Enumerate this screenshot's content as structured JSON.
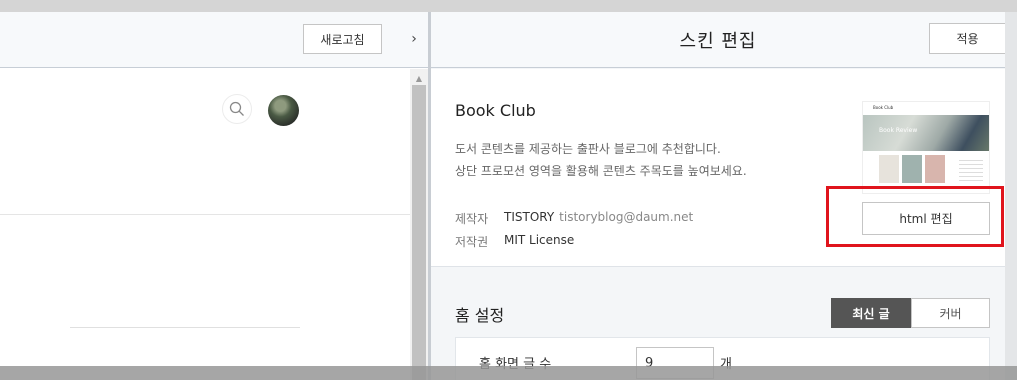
{
  "left_pane": {
    "refresh_label": "새로고침",
    "collapse_glyph": "›"
  },
  "editor": {
    "title": "스킨 편집",
    "apply_label": "적용"
  },
  "skin": {
    "name": "Book Club",
    "description_line1": "도서 콘텐츠를 제공하는 출판사 블로그에 추천합니다.",
    "description_line2": "상단 프로모션 영역을 활용해 콘텐츠 주목도를 높여보세요.",
    "maker_label": "제작자",
    "maker_name": "TISTORY",
    "maker_email": "tistoryblog@daum.net",
    "license_label": "저작권",
    "license_value": "MIT License",
    "thumbnail": {
      "blog_name": "Book Club",
      "hero_text": "Book Review"
    },
    "html_edit_label": "html 편집"
  },
  "home_settings": {
    "title": "홈 설정",
    "tabs": [
      {
        "label": "최신 글",
        "active": true
      },
      {
        "label": "커버",
        "active": false
      }
    ],
    "post_count_label": "홈 화면 글 수",
    "post_count_value": "9",
    "post_count_unit": "개"
  },
  "colors": {
    "highlight": "#e0141c",
    "active_tab": "#555555"
  }
}
